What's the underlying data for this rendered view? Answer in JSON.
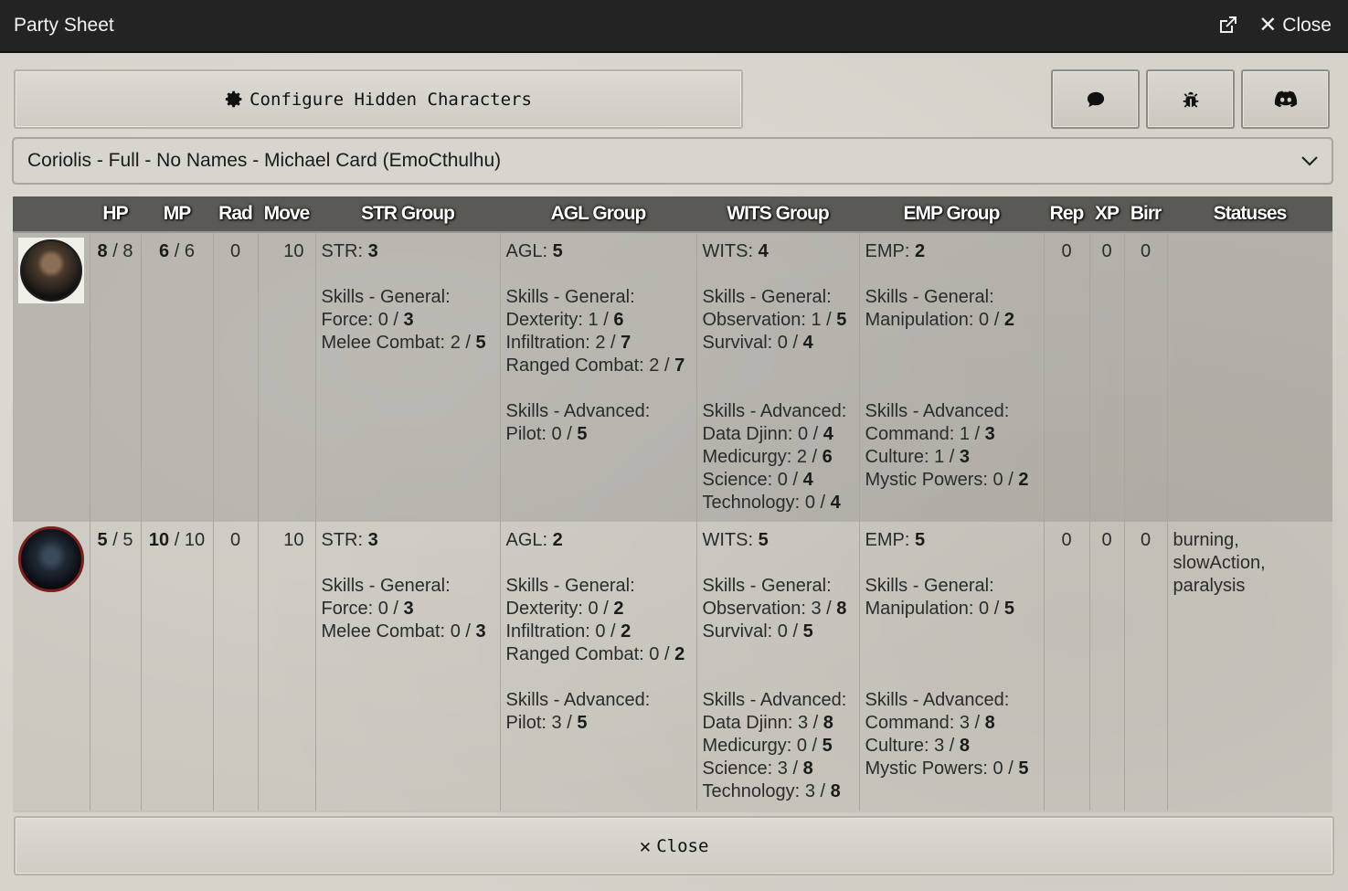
{
  "window": {
    "title": "Party Sheet",
    "close_label": "Close"
  },
  "toolbar": {
    "configure_label": "Configure Hidden Characters",
    "chat_icon": "comment-icon",
    "bug_icon": "bug-icon",
    "discord_icon": "discord-icon"
  },
  "selector": {
    "value": "Coriolis - Full - No Names - Michael Card (EmoCthulhu)"
  },
  "table": {
    "headers": [
      "",
      "HP",
      "MP",
      "Rad",
      "Move",
      "STR Group",
      "AGL Group",
      "WITS Group",
      "EMP Group",
      "Rep",
      "XP",
      "Birr",
      "Statuses"
    ],
    "skills_general_label": "Skills - General:",
    "skills_advanced_label": "Skills - Advanced:",
    "rows": [
      {
        "hp": "8",
        "hp_max": "8",
        "mp": "6",
        "mp_max": "6",
        "rad": "0",
        "move": "10",
        "str": {
          "label": "STR:",
          "value": "3",
          "general": [
            {
              "name": "Force:",
              "cur": "0",
              "max": "3"
            },
            {
              "name": "Melee Combat:",
              "cur": "2",
              "max": "5"
            }
          ]
        },
        "agl": {
          "label": "AGL:",
          "value": "5",
          "general": [
            {
              "name": "Dexterity:",
              "cur": "1",
              "max": "6"
            },
            {
              "name": "Infiltration:",
              "cur": "2",
              "max": "7"
            },
            {
              "name": "Ranged Combat:",
              "cur": "2",
              "max": "7"
            }
          ],
          "advanced": [
            {
              "name": "Pilot:",
              "cur": "0",
              "max": "5"
            }
          ]
        },
        "wits": {
          "label": "WITS:",
          "value": "4",
          "general": [
            {
              "name": "Observation:",
              "cur": "1",
              "max": "5"
            },
            {
              "name": "Survival:",
              "cur": "0",
              "max": "4"
            }
          ],
          "advanced": [
            {
              "name": "Data Djinn:",
              "cur": "0",
              "max": "4"
            },
            {
              "name": "Medicurgy:",
              "cur": "2",
              "max": "6"
            },
            {
              "name": "Science:",
              "cur": "0",
              "max": "4"
            },
            {
              "name": "Technology:",
              "cur": "0",
              "max": "4"
            }
          ]
        },
        "emp": {
          "label": "EMP:",
          "value": "2",
          "general": [
            {
              "name": "Manipulation:",
              "cur": "0",
              "max": "2"
            }
          ],
          "advanced": [
            {
              "name": "Command:",
              "cur": "1",
              "max": "3"
            },
            {
              "name": "Culture:",
              "cur": "1",
              "max": "3"
            },
            {
              "name": "Mystic Powers:",
              "cur": "0",
              "max": "2"
            }
          ]
        },
        "rep": "0",
        "xp": "0",
        "birr": "0",
        "statuses": ""
      },
      {
        "hp": "5",
        "hp_max": "5",
        "mp": "10",
        "mp_max": "10",
        "rad": "0",
        "move": "10",
        "str": {
          "label": "STR:",
          "value": "3",
          "general": [
            {
              "name": "Force:",
              "cur": "0",
              "max": "3"
            },
            {
              "name": "Melee Combat:",
              "cur": "0",
              "max": "3"
            }
          ]
        },
        "agl": {
          "label": "AGL:",
          "value": "2",
          "general": [
            {
              "name": "Dexterity:",
              "cur": "0",
              "max": "2"
            },
            {
              "name": "Infiltration:",
              "cur": "0",
              "max": "2"
            },
            {
              "name": "Ranged Combat:",
              "cur": "0",
              "max": "2"
            }
          ],
          "advanced": [
            {
              "name": "Pilot:",
              "cur": "3",
              "max": "5"
            }
          ]
        },
        "wits": {
          "label": "WITS:",
          "value": "5",
          "general": [
            {
              "name": "Observation:",
              "cur": "3",
              "max": "8"
            },
            {
              "name": "Survival:",
              "cur": "0",
              "max": "5"
            }
          ],
          "advanced": [
            {
              "name": "Data Djinn:",
              "cur": "3",
              "max": "8"
            },
            {
              "name": "Medicurgy:",
              "cur": "0",
              "max": "5"
            },
            {
              "name": "Science:",
              "cur": "3",
              "max": "8"
            },
            {
              "name": "Technology:",
              "cur": "3",
              "max": "8"
            }
          ]
        },
        "emp": {
          "label": "EMP:",
          "value": "5",
          "general": [
            {
              "name": "Manipulation:",
              "cur": "0",
              "max": "5"
            }
          ],
          "advanced": [
            {
              "name": "Command:",
              "cur": "3",
              "max": "8"
            },
            {
              "name": "Culture:",
              "cur": "3",
              "max": "8"
            },
            {
              "name": "Mystic Powers:",
              "cur": "0",
              "max": "5"
            }
          ]
        },
        "rep": "0",
        "xp": "0",
        "birr": "0",
        "statuses": "burning, slowAction, paralysis"
      }
    ]
  },
  "footer": {
    "close_label": "Close"
  }
}
